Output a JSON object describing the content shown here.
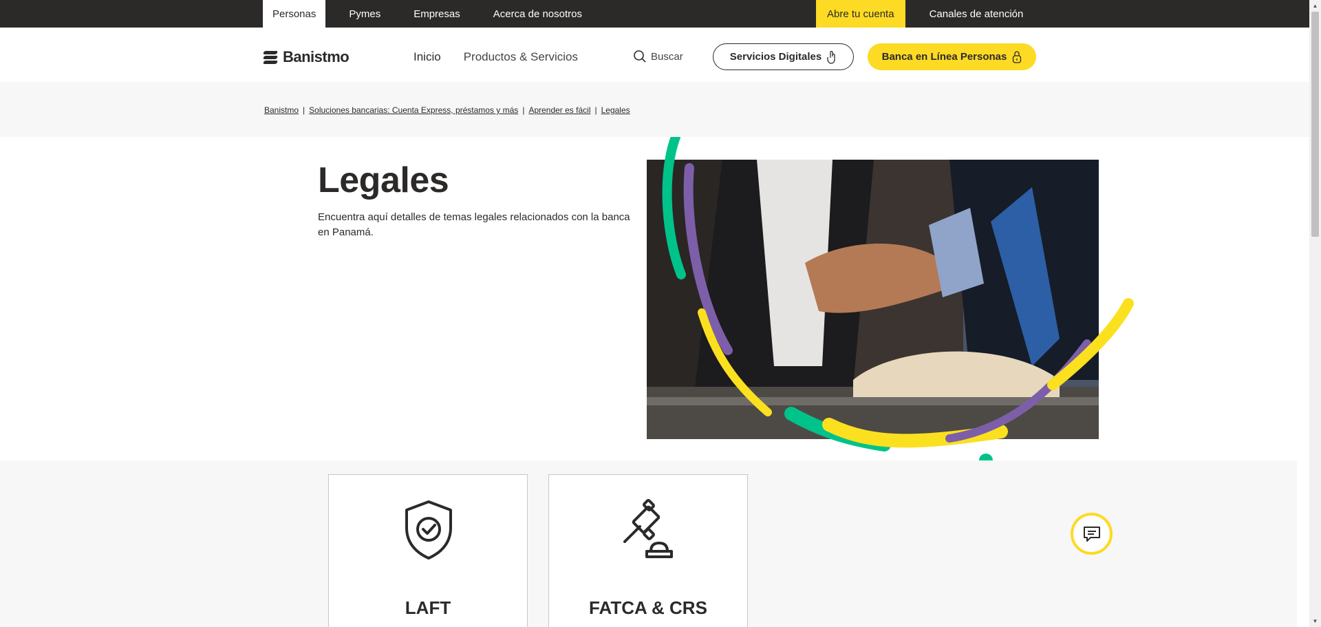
{
  "topbar": {
    "tabs": [
      "Personas",
      "Pymes",
      "Empresas",
      "Acerca de nosotros"
    ],
    "open_account": "Abre tu cuenta",
    "channels": "Canales de atención"
  },
  "header": {
    "logo_text": "Banistmo",
    "nav": [
      "Inicio",
      "Productos & Servicios"
    ],
    "search_label": "Buscar",
    "digital_services": "Servicios Digitales",
    "online_banking": "Banca en Línea Personas"
  },
  "breadcrumb": [
    "Banistmo",
    "Soluciones bancarias: Cuenta Express, préstamos y más",
    "Aprender es fácil",
    "Legales"
  ],
  "hero": {
    "title": "Legales",
    "description": "Encuentra aquí detalles de temas legales relacionados con la banca en Panamá."
  },
  "cards": [
    {
      "label": "LAFT",
      "icon": "shield-check-icon"
    },
    {
      "label": "FATCA & CRS",
      "icon": "gavel-icon"
    }
  ],
  "colors": {
    "brand_yellow": "#fdda24",
    "dark": "#2c2a29",
    "green": "#00c389",
    "purple": "#7c5fa8"
  }
}
